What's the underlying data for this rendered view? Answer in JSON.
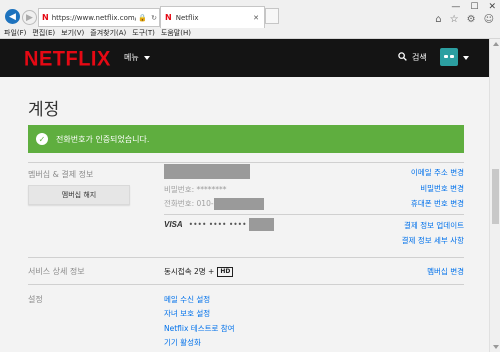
{
  "browser": {
    "url": "https://www.netflix.com/y...",
    "tab_title": "Netflix",
    "tab_favicon": "N",
    "menu": [
      "파일(F)",
      "편집(E)",
      "보기(V)",
      "즐겨찾기(A)",
      "도구(T)",
      "도움말(H)"
    ],
    "window_controls": [
      "minimize-icon",
      "maximize-icon",
      "close-icon"
    ],
    "toolbar_icons": [
      "home-icon",
      "star-icon",
      "gear-icon",
      "smiley-icon"
    ]
  },
  "header": {
    "logo": "NETFLIX",
    "menu_label": "메뉴",
    "search_label": "검색",
    "avatar_color": "#2c9fa1",
    "brand_color": "#e50914"
  },
  "page": {
    "title": "계정",
    "alert": {
      "text": "전화번호가 인증되었습니다.",
      "color": "#5fae3f"
    },
    "membership": {
      "label": "멤버십 & 결제 정보",
      "cancel_button": "멤버십 해지",
      "password_label": "비밀번호:",
      "password_value": "********",
      "phone_label": "전화번호:",
      "phone_prefix": "010-",
      "card_brand": "VISA",
      "card_masked": "•••• •••• ••••",
      "links": {
        "change_email": "이메일 주소 변경",
        "change_password": "비밀번호 변경",
        "change_phone": "휴대폰 번호 변경",
        "update_payment": "결제 정보 업데이트",
        "billing_details": "결제 정보 세부 사항"
      }
    },
    "plan": {
      "label": "서비스 상세 정보",
      "description": "동시접속 2명 +",
      "badge": "HD",
      "change_link": "멤버십 변경"
    },
    "settings": {
      "label": "설정",
      "links": [
        "메일 수신 설정",
        "자녀 보호 설정",
        "Netflix 테스트로 참여",
        "기기 활성화"
      ]
    }
  }
}
